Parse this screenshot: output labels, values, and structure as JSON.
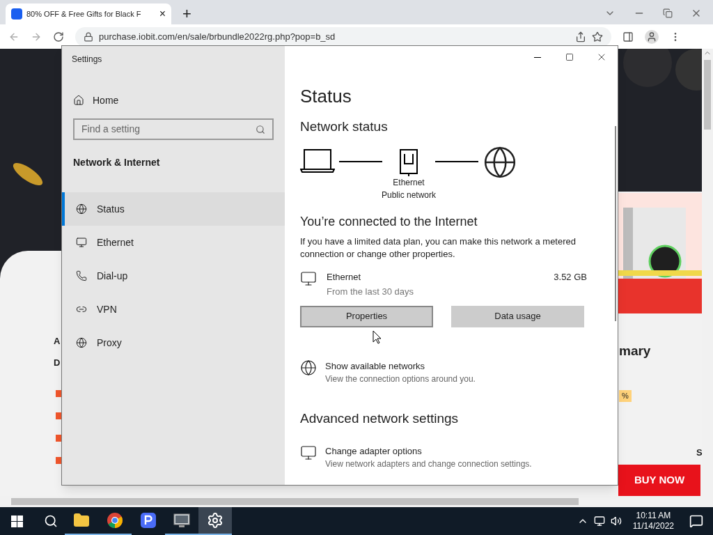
{
  "browser": {
    "tab_title": "80% OFF & Free Gifts for Black F",
    "tab_close": "×",
    "new_tab": "+",
    "address": "purchase.iobit.com/en/sale/brbundle2022rg.php?pop=b_sd"
  },
  "page": {
    "left_texts": [
      "A",
      "D"
    ],
    "heading": "mary",
    "badge": "%",
    "right_letter": "S",
    "buy_button": "BUY NOW"
  },
  "settings": {
    "title": "Settings",
    "home": "Home",
    "search": {
      "placeholder": "Find a setting"
    },
    "section": "Network & Internet",
    "nav": [
      {
        "label": "Status",
        "kind": "status",
        "selected": true
      },
      {
        "label": "Ethernet",
        "kind": "ethernet",
        "selected": false
      },
      {
        "label": "Dial-up",
        "kind": "dialup",
        "selected": false
      },
      {
        "label": "VPN",
        "kind": "vpn",
        "selected": false
      },
      {
        "label": "Proxy",
        "kind": "proxy",
        "selected": false
      }
    ],
    "page_title": "Status",
    "network_status": "Network status",
    "adapter": "Ethernet",
    "network_type": "Public network",
    "connected": "You’re connected to the Internet",
    "description": "If you have a limited data plan, you can make this network a metered connection or change other properties.",
    "usage": {
      "name": "Ethernet",
      "period": "From the last 30 days",
      "amount": "3.52 GB"
    },
    "buttons": [
      {
        "label": "Properties",
        "focused": true
      },
      {
        "label": "Data usage",
        "focused": false
      }
    ],
    "links": [
      {
        "title": "Show available networks",
        "subtitle": "View the connection options around you.",
        "kind": "globe"
      }
    ],
    "advanced": "Advanced network settings",
    "advanced_links": [
      {
        "title": "Change adapter options",
        "subtitle": "View network adapters and change connection settings.",
        "kind": "monitor"
      }
    ]
  },
  "taskbar": {
    "apps": [
      {
        "kind": "explorer",
        "running": true,
        "active": false
      },
      {
        "kind": "chrome",
        "running": true,
        "active": false
      },
      {
        "kind": "p",
        "running": false,
        "active": false
      },
      {
        "kind": "screen",
        "running": true,
        "active": false
      },
      {
        "kind": "settings",
        "running": true,
        "active": true
      }
    ],
    "time": "10:11 AM",
    "date": "11/14/2022"
  }
}
